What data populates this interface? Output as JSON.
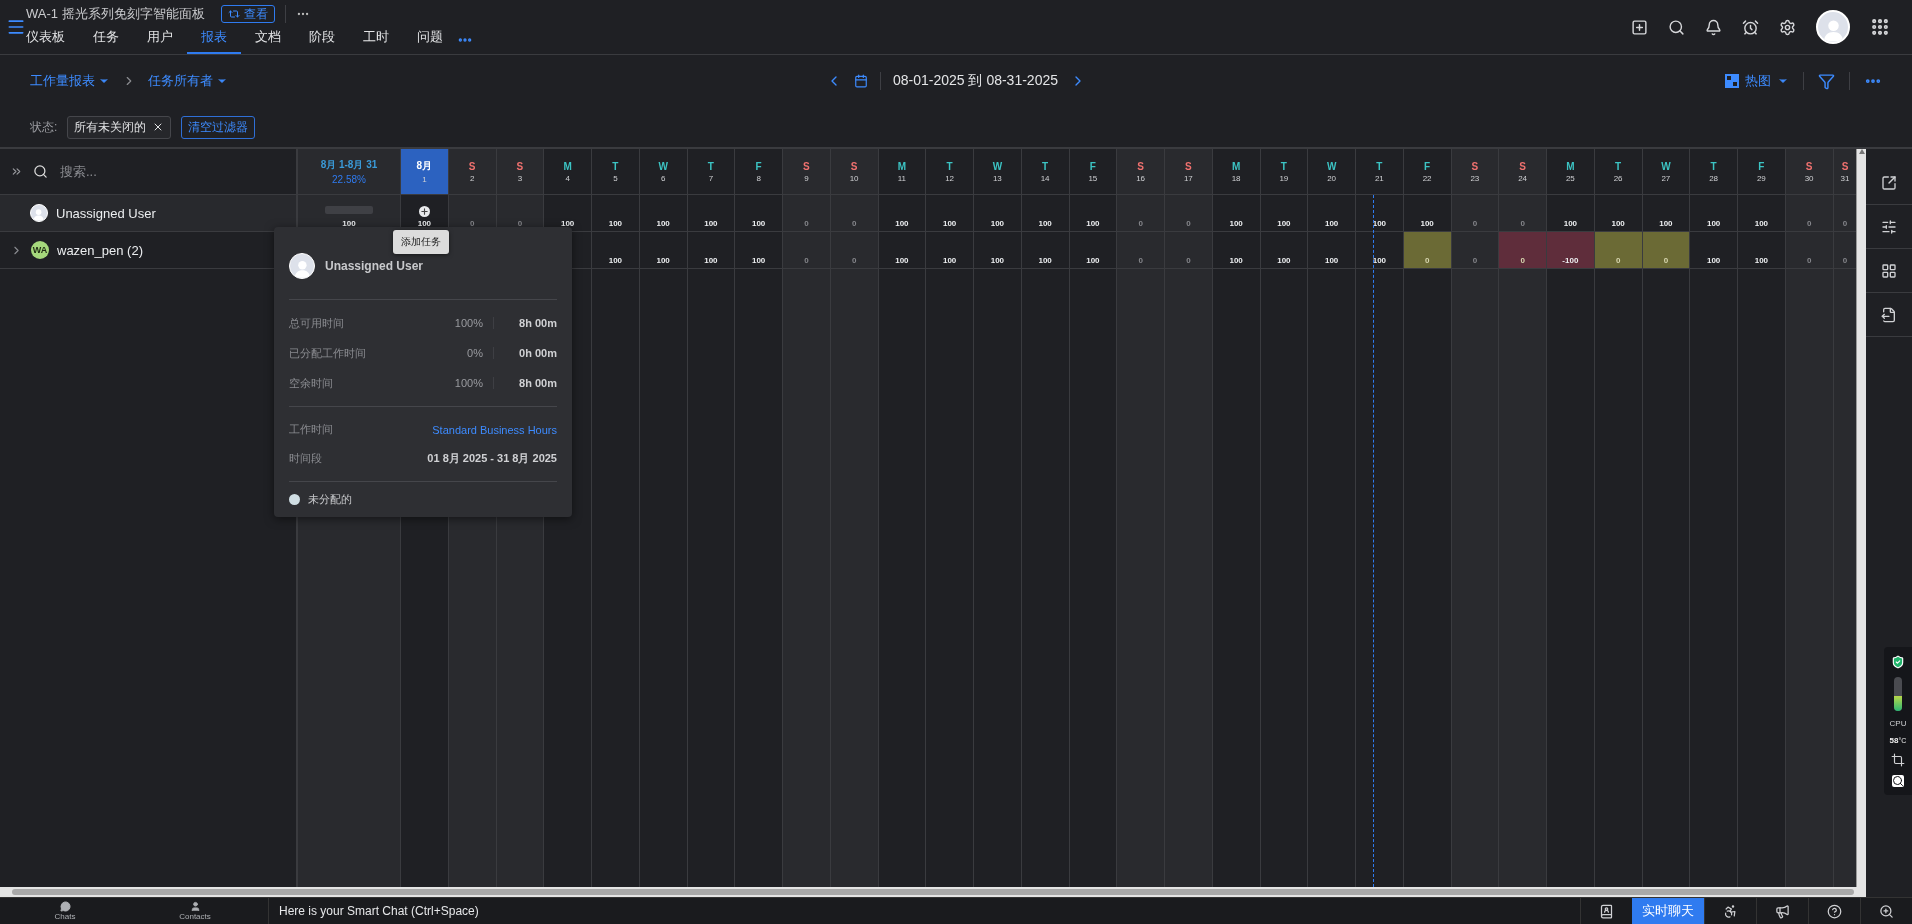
{
  "header": {
    "title": "WA-1 摇光系列免刻字智能面板",
    "view_button": "查看",
    "tabs": [
      {
        "label": "仪表板",
        "selected": false
      },
      {
        "label": "任务",
        "selected": false
      },
      {
        "label": "用户",
        "selected": false
      },
      {
        "label": "报表",
        "selected": true
      },
      {
        "label": "文档",
        "selected": false
      },
      {
        "label": "阶段",
        "selected": false
      },
      {
        "label": "工时",
        "selected": false
      },
      {
        "label": "问题",
        "selected": false
      }
    ]
  },
  "toolbar": {
    "breadcrumbs": [
      "工作量报表",
      "任务所有者"
    ],
    "date_range": "08-01-2025 到 08-31-2025",
    "view_mode": "热图"
  },
  "filters": {
    "label": "状态:",
    "chips": [
      "所有未关闭的"
    ],
    "clear": "清空过滤器"
  },
  "sidebar": {
    "search_placeholder": "搜索...",
    "rows": [
      {
        "name": "Unassigned User"
      },
      {
        "name": "wazen_pen (2)",
        "initials": "WA",
        "expanded": false
      }
    ]
  },
  "grid": {
    "summary": {
      "range": "8月 1-8月 31",
      "percent": "22.58%"
    },
    "days": [
      {
        "letter": "8月",
        "date": "1",
        "weekend": false,
        "selected": true
      },
      {
        "letter": "S",
        "date": "2",
        "weekend": true,
        "selected": false
      },
      {
        "letter": "S",
        "date": "3",
        "weekend": true,
        "selected": false
      },
      {
        "letter": "M",
        "date": "4",
        "weekend": false,
        "selected": false
      },
      {
        "letter": "T",
        "date": "5",
        "weekend": false,
        "selected": false
      },
      {
        "letter": "W",
        "date": "6",
        "weekend": false,
        "selected": false
      },
      {
        "letter": "T",
        "date": "7",
        "weekend": false,
        "selected": false
      },
      {
        "letter": "F",
        "date": "8",
        "weekend": false,
        "selected": false
      },
      {
        "letter": "S",
        "date": "9",
        "weekend": true,
        "selected": false
      },
      {
        "letter": "S",
        "date": "10",
        "weekend": true,
        "selected": false
      },
      {
        "letter": "M",
        "date": "11",
        "weekend": false,
        "selected": false
      },
      {
        "letter": "T",
        "date": "12",
        "weekend": false,
        "selected": false
      },
      {
        "letter": "W",
        "date": "13",
        "weekend": false,
        "selected": false
      },
      {
        "letter": "T",
        "date": "14",
        "weekend": false,
        "selected": false
      },
      {
        "letter": "F",
        "date": "15",
        "weekend": false,
        "selected": false
      },
      {
        "letter": "S",
        "date": "16",
        "weekend": true,
        "selected": false
      },
      {
        "letter": "S",
        "date": "17",
        "weekend": true,
        "selected": false
      },
      {
        "letter": "M",
        "date": "18",
        "weekend": false,
        "selected": false
      },
      {
        "letter": "T",
        "date": "19",
        "weekend": false,
        "selected": false
      },
      {
        "letter": "W",
        "date": "20",
        "weekend": false,
        "selected": false
      },
      {
        "letter": "T",
        "date": "21",
        "weekend": false,
        "selected": false,
        "today": true
      },
      {
        "letter": "F",
        "date": "22",
        "weekend": false,
        "selected": false
      },
      {
        "letter": "S",
        "date": "23",
        "weekend": true,
        "selected": false
      },
      {
        "letter": "S",
        "date": "24",
        "weekend": true,
        "selected": false
      },
      {
        "letter": "M",
        "date": "25",
        "weekend": false,
        "selected": false
      },
      {
        "letter": "T",
        "date": "26",
        "weekend": false,
        "selected": false
      },
      {
        "letter": "W",
        "date": "27",
        "weekend": false,
        "selected": false
      },
      {
        "letter": "T",
        "date": "28",
        "weekend": false,
        "selected": false
      },
      {
        "letter": "F",
        "date": "29",
        "weekend": false,
        "selected": false
      },
      {
        "letter": "S",
        "date": "30",
        "weekend": true,
        "selected": false
      },
      {
        "letter": "S",
        "date": "31",
        "weekend": true,
        "selected": false
      }
    ],
    "rows": [
      {
        "summary": "100",
        "cells": [
          {
            "value": "100",
            "dim": false,
            "hovered": true
          },
          {
            "value": "0",
            "dim": true,
            "hovered": false
          },
          {
            "value": "0",
            "dim": true,
            "hovered": false
          },
          {
            "value": "100",
            "dim": false,
            "hovered": false
          },
          {
            "value": "100",
            "dim": false,
            "hovered": false
          },
          {
            "value": "100",
            "dim": false,
            "hovered": false
          },
          {
            "value": "100",
            "dim": false,
            "hovered": false
          },
          {
            "value": "100",
            "dim": false,
            "hovered": false
          },
          {
            "value": "0",
            "dim": true,
            "hovered": false
          },
          {
            "value": "0",
            "dim": true,
            "hovered": false
          },
          {
            "value": "100",
            "dim": false,
            "hovered": false
          },
          {
            "value": "100",
            "dim": false,
            "hovered": false
          },
          {
            "value": "100",
            "dim": false,
            "hovered": false
          },
          {
            "value": "100",
            "dim": false,
            "hovered": false
          },
          {
            "value": "100",
            "dim": false,
            "hovered": false
          },
          {
            "value": "0",
            "dim": true,
            "hovered": false
          },
          {
            "value": "0",
            "dim": true,
            "hovered": false
          },
          {
            "value": "100",
            "dim": false,
            "hovered": false
          },
          {
            "value": "100",
            "dim": false,
            "hovered": false
          },
          {
            "value": "100",
            "dim": false,
            "hovered": false
          },
          {
            "value": "100",
            "dim": false,
            "hovered": false
          },
          {
            "value": "100",
            "dim": false,
            "hovered": false
          },
          {
            "value": "0",
            "dim": true,
            "hovered": false
          },
          {
            "value": "0",
            "dim": true,
            "hovered": false
          },
          {
            "value": "100",
            "dim": false,
            "hovered": false
          },
          {
            "value": "100",
            "dim": false,
            "hovered": false
          },
          {
            "value": "100",
            "dim": false,
            "hovered": false
          },
          {
            "value": "100",
            "dim": false,
            "hovered": false
          },
          {
            "value": "100",
            "dim": false,
            "hovered": false
          },
          {
            "value": "0",
            "dim": true,
            "hovered": false
          },
          {
            "value": "0",
            "dim": true,
            "hovered": false
          }
        ]
      },
      {
        "cells": [
          null,
          null,
          null,
          null,
          {
            "value": "100",
            "dim": false
          },
          {
            "value": "100",
            "dim": false
          },
          {
            "value": "100",
            "dim": false
          },
          {
            "value": "100",
            "dim": false
          },
          {
            "value": "0",
            "dim": true
          },
          {
            "value": "0",
            "dim": true
          },
          {
            "value": "100",
            "dim": false
          },
          {
            "value": "100",
            "dim": false
          },
          {
            "value": "100",
            "dim": false
          },
          {
            "value": "100",
            "dim": false
          },
          {
            "value": "100",
            "dim": false
          },
          {
            "value": "0",
            "dim": true
          },
          {
            "value": "0",
            "dim": true
          },
          {
            "value": "100",
            "dim": false
          },
          {
            "value": "100",
            "dim": false
          },
          {
            "value": "100",
            "dim": false
          },
          {
            "value": "100",
            "dim": false
          },
          {
            "value": "0",
            "dim": true,
            "color": "#6b6a35"
          },
          {
            "value": "0",
            "dim": true
          },
          {
            "value": "0",
            "dim": true,
            "color": "#5f2d3b"
          },
          {
            "value": "-100",
            "dim": false,
            "color": "#5f2d3b"
          },
          {
            "value": "0",
            "dim": true,
            "color": "#6b6a35"
          },
          {
            "value": "0",
            "dim": true,
            "color": "#6b6a35"
          },
          {
            "value": "100",
            "dim": false
          },
          {
            "value": "100",
            "dim": false
          },
          {
            "value": "0",
            "dim": true
          },
          {
            "value": "0",
            "dim": true
          }
        ]
      }
    ],
    "add_task_tooltip": "添加任务"
  },
  "popover": {
    "name": "Unassigned User",
    "stats": [
      {
        "label": "总可用时间",
        "percent": "100%",
        "time": "8h 00m"
      },
      {
        "label": "已分配工作时间",
        "percent": "0%",
        "time": "0h 00m"
      },
      {
        "label": "空余时间",
        "percent": "100%",
        "time": "8h 00m"
      }
    ],
    "details": [
      {
        "label": "工作时间",
        "value": "Standard Business Hours",
        "kind": "link"
      },
      {
        "label": "时间段",
        "value": "01 8月 2025 - 31 8月 2025",
        "kind": "text"
      }
    ],
    "legend": {
      "label": "未分配的",
      "color": "#cfdde3"
    }
  },
  "monitor": {
    "label": "CPU",
    "temperature": "58",
    "unit": "°C",
    "level": 0.45
  },
  "bottom_bar": {
    "nav": [
      "Chats",
      "Contacts"
    ],
    "chat_prompt": "Here is your Smart Chat (Ctrl+Space)",
    "live_chat": "实时聊天"
  }
}
